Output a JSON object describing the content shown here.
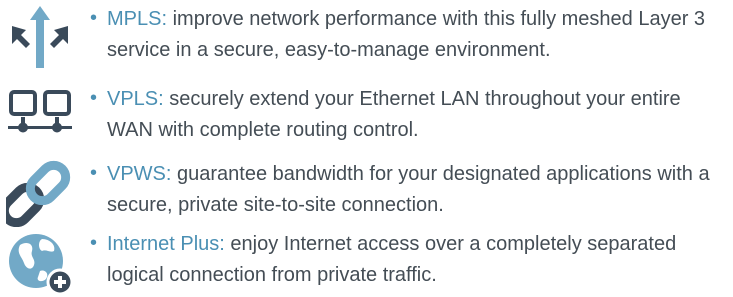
{
  "colors": {
    "icon_navy": "#3a4a5a",
    "icon_blue": "#72a9c7",
    "term_blue": "#4a8fb3",
    "body_gray": "#444d55"
  },
  "items": [
    {
      "icon": "network-arrows-icon",
      "term": "MPLS:",
      "description": "improve network performance with this fully meshed Layer 3 service in a secure, easy-to-manage environment."
    },
    {
      "icon": "connected-screens-icon",
      "term": "VPLS:",
      "description": "securely extend your Ethernet LAN throughout your entire WAN with complete routing control."
    },
    {
      "icon": "chain-link-icon",
      "term": "VPWS:",
      "description": "guarantee bandwidth for your designated applications with a secure, private site-to-site connection."
    },
    {
      "icon": "globe-plus-icon",
      "term": "Internet Plus:",
      "description": "enjoy Internet access over a completely separated logical connection from private traffic."
    }
  ]
}
